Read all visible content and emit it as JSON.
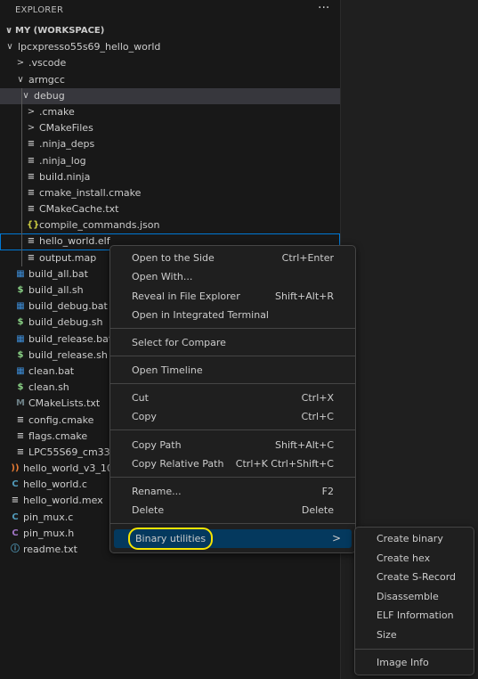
{
  "explorer": {
    "title": "EXPLORER",
    "more": "···",
    "workspace": "MY (WORKSPACE)"
  },
  "tree": [
    {
      "label": "lpcxpresso55s69_hello_world",
      "chev": "∨",
      "icon": "",
      "icon_color": "#cccccc",
      "label_color": "#cccccc"
    },
    {
      "label": ".vscode",
      "chev": ">",
      "icon": "",
      "icon_color": "#cccccc",
      "label_color": "#cccccc"
    },
    {
      "label": "armgcc",
      "chev": "∨",
      "icon": "",
      "icon_color": "#cccccc",
      "label_color": "#cccccc"
    },
    {
      "label": "debug",
      "chev": "∨",
      "icon": "",
      "icon_color": "#cccccc",
      "label_color": "#cccccc"
    },
    {
      "label": ".cmake",
      "chev": ">",
      "icon": "",
      "icon_color": "#cccccc",
      "label_color": "#cccccc"
    },
    {
      "label": "CMakeFiles",
      "chev": ">",
      "icon": "",
      "icon_color": "#cccccc",
      "label_color": "#cccccc"
    },
    {
      "label": ".ninja_deps",
      "chev": "",
      "icon": "≡",
      "icon_color": "#c5c5c5",
      "label_color": "#cccccc"
    },
    {
      "label": ".ninja_log",
      "chev": "",
      "icon": "≡",
      "icon_color": "#c5c5c5",
      "label_color": "#cccccc"
    },
    {
      "label": "build.ninja",
      "chev": "",
      "icon": "≡",
      "icon_color": "#c5c5c5",
      "label_color": "#cccccc"
    },
    {
      "label": "cmake_install.cmake",
      "chev": "",
      "icon": "≡",
      "icon_color": "#c5c5c5",
      "label_color": "#cccccc"
    },
    {
      "label": "CMakeCache.txt",
      "chev": "",
      "icon": "≡",
      "icon_color": "#c5c5c5",
      "label_color": "#cccccc"
    },
    {
      "label": "compile_commands.json",
      "chev": "",
      "icon": "{}",
      "icon_color": "#cbcb41",
      "label_color": "#cccccc"
    },
    {
      "label": "hello_world.elf",
      "chev": "",
      "icon": "≡",
      "icon_color": "#c5c5c5",
      "label_color": "#cccccc"
    },
    {
      "label": "output.map",
      "chev": "",
      "icon": "≡",
      "icon_color": "#c5c5c5",
      "label_color": "#cccccc"
    },
    {
      "label": "build_all.bat",
      "chev": "",
      "icon": "▦",
      "icon_color": "#3c8cd6",
      "label_color": "#cccccc"
    },
    {
      "label": "build_all.sh",
      "chev": "",
      "icon": "$",
      "icon_color": "#89d185",
      "label_color": "#cccccc"
    },
    {
      "label": "build_debug.bat",
      "chev": "",
      "icon": "▦",
      "icon_color": "#3c8cd6",
      "label_color": "#cccccc"
    },
    {
      "label": "build_debug.sh",
      "chev": "",
      "icon": "$",
      "icon_color": "#89d185",
      "label_color": "#cccccc"
    },
    {
      "label": "build_release.bat",
      "chev": "",
      "icon": "▦",
      "icon_color": "#3c8cd6",
      "label_color": "#cccccc"
    },
    {
      "label": "build_release.sh",
      "chev": "",
      "icon": "$",
      "icon_color": "#89d185",
      "label_color": "#cccccc"
    },
    {
      "label": "clean.bat",
      "chev": "",
      "icon": "▦",
      "icon_color": "#3c8cd6",
      "label_color": "#cccccc"
    },
    {
      "label": "clean.sh",
      "chev": "",
      "icon": "$",
      "icon_color": "#89d185",
      "label_color": "#cccccc"
    },
    {
      "label": "CMakeLists.txt",
      "chev": "",
      "icon": "M",
      "icon_color": "#6d8086",
      "label_color": "#cccccc"
    },
    {
      "label": "config.cmake",
      "chev": "",
      "icon": "≡",
      "icon_color": "#c5c5c5",
      "label_color": "#cccccc"
    },
    {
      "label": "flags.cmake",
      "chev": "",
      "icon": "≡",
      "icon_color": "#c5c5c5",
      "label_color": "#cccccc"
    },
    {
      "label": "LPC55S69_cm33_",
      "chev": "",
      "icon": "≡",
      "icon_color": "#c5c5c5",
      "label_color": "#cccccc"
    },
    {
      "label": "hello_world_v3_10",
      "chev": "",
      "icon": "))",
      "icon_color": "#e37933",
      "label_color": "#cccccc"
    },
    {
      "label": "hello_world.c",
      "chev": "",
      "icon": "C",
      "icon_color": "#519aba",
      "label_color": "#cccccc"
    },
    {
      "label": "hello_world.mex",
      "chev": "",
      "icon": "≡",
      "icon_color": "#c5c5c5",
      "label_color": "#cccccc"
    },
    {
      "label": "pin_mux.c",
      "chev": "",
      "icon": "C",
      "icon_color": "#519aba",
      "label_color": "#cccccc"
    },
    {
      "label": "pin_mux.h",
      "chev": "",
      "icon": "C",
      "icon_color": "#a074c4",
      "label_color": "#cccccc"
    },
    {
      "label": "readme.txt",
      "chev": "",
      "icon": "ⓘ",
      "icon_color": "#519aba",
      "label_color": "#cccccc"
    }
  ],
  "context_menu": {
    "items": [
      {
        "label": "Open to the Side",
        "shortcut": "Ctrl+Enter"
      },
      {
        "label": "Open With...",
        "shortcut": ""
      },
      {
        "label": "Reveal in File Explorer",
        "shortcut": "Shift+Alt+R"
      },
      {
        "label": "Open in Integrated Terminal",
        "shortcut": ""
      },
      {
        "label": "Select for Compare",
        "shortcut": ""
      },
      {
        "label": "Open Timeline",
        "shortcut": ""
      },
      {
        "label": "Cut",
        "shortcut": "Ctrl+X"
      },
      {
        "label": "Copy",
        "shortcut": "Ctrl+C"
      },
      {
        "label": "Copy Path",
        "shortcut": "Shift+Alt+C"
      },
      {
        "label": "Copy Relative Path",
        "shortcut": "Ctrl+K Ctrl+Shift+C"
      },
      {
        "label": "Rename...",
        "shortcut": "F2"
      },
      {
        "label": "Delete",
        "shortcut": "Delete"
      }
    ],
    "binary_utilities": "Binary utilities",
    "submenu_arrow": ">"
  },
  "submenu": {
    "items": [
      "Create binary",
      "Create hex",
      "Create S-Record",
      "Disassemble",
      "ELF Information",
      "Size",
      "Image Info"
    ]
  },
  "colors": {
    "selection": "#37373d",
    "menu_highlight": "#04395e",
    "focus_border": "#0078d4",
    "annotation": "#f5e400"
  }
}
